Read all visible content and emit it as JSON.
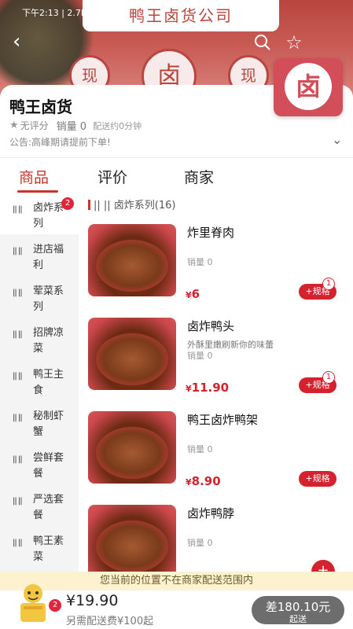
{
  "status_bar": {
    "time_speed": "下午2:13 | 2.7K/s"
  },
  "banner": {
    "sign_text": "鸭王卤货公司",
    "seal_left": "现",
    "seal_center": "卤",
    "seal_right": "现"
  },
  "store": {
    "name": "鸭王卤货",
    "logo_char": "卤",
    "rating": "无评分",
    "sales": "销量 0",
    "delivery_time": "配送约0分钟",
    "notice": "公告:高峰期请提前下单!"
  },
  "tabs": [
    {
      "label": "商品"
    },
    {
      "label": "评价"
    },
    {
      "label": "商家"
    }
  ],
  "categories": [
    {
      "label": "卤炸系列",
      "badge": "2"
    },
    {
      "label": "进店福利"
    },
    {
      "label": "荤菜系列"
    },
    {
      "label": "招牌凉菜"
    },
    {
      "label": "鸭王主食"
    },
    {
      "label": "秘制虾蟹"
    },
    {
      "label": "尝鲜套餐"
    },
    {
      "label": "严选套餐"
    },
    {
      "label": "鸭王素菜"
    }
  ],
  "section": {
    "title": "卤炸系列(16)"
  },
  "products": [
    {
      "name": "炸里脊肉",
      "desc": "",
      "sold": "销量 0",
      "currency": "¥",
      "price": "6",
      "spec_label": "+规格",
      "count": "1"
    },
    {
      "name": "卤炸鸭头",
      "desc": "外酥里嫩刷新你的味蕾",
      "sold": "销量 0",
      "currency": "¥",
      "price": "11.90",
      "spec_label": "+规格",
      "count": "1"
    },
    {
      "name": "鸭王卤炸鸭架",
      "desc": "",
      "sold": "销量 0",
      "currency": "¥",
      "price": "8.90",
      "spec_label": "+规格",
      "count": ""
    },
    {
      "name": "卤炸鸭脖",
      "desc": "",
      "sold": "销量 0",
      "currency": "",
      "price": "",
      "spec_label": "",
      "count": ""
    }
  ],
  "footer": {
    "warning": "您当前的位置不在商家配送范围内",
    "cart_count": "2",
    "total": "¥19.90",
    "delivery_fee": "另需配送费¥100起",
    "checkout_amount": "差180.10元",
    "checkout_label": "起送"
  }
}
